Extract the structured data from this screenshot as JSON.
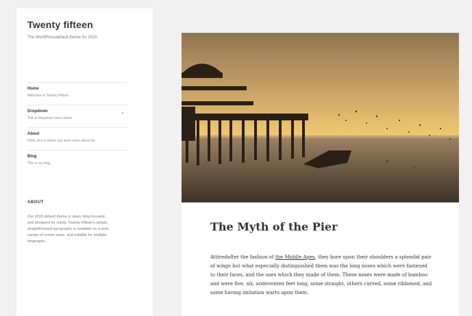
{
  "site": {
    "title": "Twenty fifteen",
    "description": "The WordPressdefault theme for 2015."
  },
  "menu": [
    {
      "label": "Home",
      "sub": "Welcome to Twenty Fifteen"
    },
    {
      "label": "Dropdown",
      "sub": "This is dropdown menu items"
    },
    {
      "label": "About",
      "sub": "Hello, this is where you learn more about me"
    },
    {
      "label": "Blog",
      "sub": "This is my blog"
    }
  ],
  "widget": {
    "title": "ABOUT",
    "text": "Our 2015 default theme is clean, blog-focused, and designed for clarity. Twenty Fifteen's simple, straightforward typography is readable on a wide variety of screen sizes, and suitable for multiple languages."
  },
  "post": {
    "title": "The Myth of the Pier",
    "body_before_link": "Attiredafter the fashion of ",
    "link_text": "the Middle Ages",
    "body_after_link": ", they bore upon their shoulders a splendid pair of wings but what especially distinguished them was the long noses which were fastened to their faces, and the uses which they made of them. These noses were made of bamboo and were five, six, andeventen feet long, some straight, others curved, some ribboned, and some having imitation warts upon them."
  },
  "colors": {
    "sky_top": "#8f7550",
    "sky_glow": "#f0c870",
    "sea": "#6e5a44",
    "pier": "#2a2016"
  }
}
